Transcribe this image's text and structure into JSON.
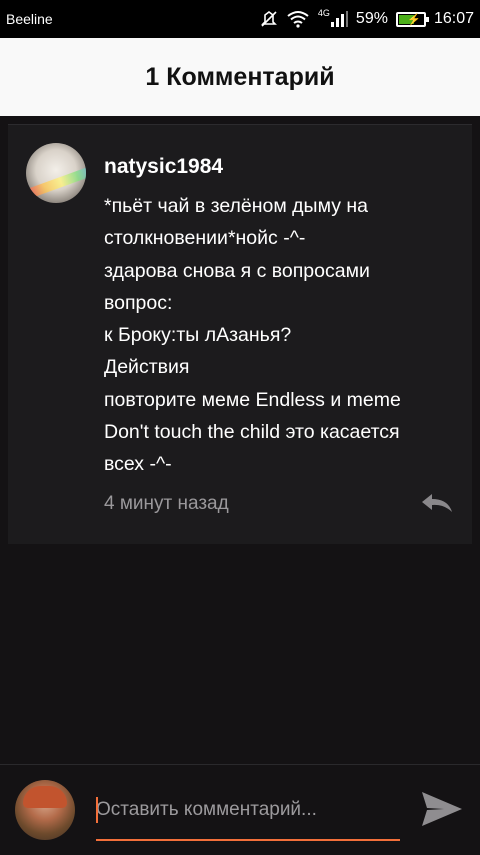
{
  "status_bar": {
    "carrier": "Beeline",
    "network": "4G",
    "battery": "59%",
    "time": "16:07",
    "icons": [
      "mute-icon",
      "wifi-icon",
      "signal-icon",
      "battery-charging-icon"
    ]
  },
  "header": {
    "title": "1 Комментарий"
  },
  "comment": {
    "author": "natysic1984",
    "lines": [
      "*пьёт чай в зелёном дыму на",
      "столкновении*нойс -^-",
      "здарова снова я с вопросами",
      "вопрос:",
      "к Броку:ты лАзанья?",
      "Действия",
      "повторите меме Endless и meme",
      "Don't touch the child это касается",
      "всех -^-"
    ],
    "time_ago": "4 минут назад",
    "reply_icon": "reply-icon"
  },
  "composer": {
    "placeholder": "Оставить комментарий...",
    "value": "",
    "send_icon": "send-icon",
    "accent_color": "#f36f3a"
  }
}
